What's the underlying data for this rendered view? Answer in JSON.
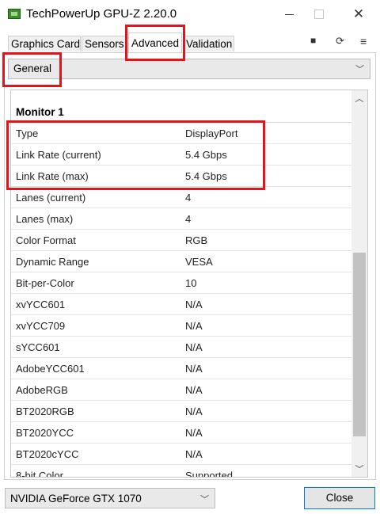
{
  "window": {
    "title": "TechPowerUp GPU-Z 2.20.0"
  },
  "tabs": [
    {
      "label": "Graphics Card"
    },
    {
      "label": "Sensors"
    },
    {
      "label": "Advanced"
    },
    {
      "label": "Validation"
    }
  ],
  "toolbar": {
    "icons": [
      "camera-icon",
      "refresh-icon",
      "menu-icon"
    ]
  },
  "category": {
    "selected": "General"
  },
  "monitor": {
    "header": "Monitor 1",
    "rows": [
      {
        "key": "Type",
        "value": "DisplayPort"
      },
      {
        "key": "Link Rate (current)",
        "value": "5.4 Gbps"
      },
      {
        "key": "Link Rate (max)",
        "value": "5.4 Gbps"
      },
      {
        "key": "Lanes (current)",
        "value": "4"
      },
      {
        "key": "Lanes (max)",
        "value": "4"
      },
      {
        "key": "Color Format",
        "value": "RGB"
      },
      {
        "key": "Dynamic Range",
        "value": "VESA"
      },
      {
        "key": "Bit-per-Color",
        "value": "10"
      },
      {
        "key": "xvYCC601",
        "value": "N/A"
      },
      {
        "key": "xvYCC709",
        "value": "N/A"
      },
      {
        "key": "sYCC601",
        "value": "N/A"
      },
      {
        "key": "AdobeYCC601",
        "value": "N/A"
      },
      {
        "key": "AdobeRGB",
        "value": "N/A"
      },
      {
        "key": "BT2020RGB",
        "value": "N/A"
      },
      {
        "key": "BT2020YCC",
        "value": "N/A"
      },
      {
        "key": "BT2020cYCC",
        "value": "N/A"
      },
      {
        "key": "8-bit Color",
        "value": "Supported"
      }
    ]
  },
  "footer": {
    "gpu_selected": "NVIDIA GeForce GTX 1070",
    "close_label": "Close"
  },
  "colors": {
    "highlight": "#e4141b",
    "focus_border": "#0078d7"
  }
}
